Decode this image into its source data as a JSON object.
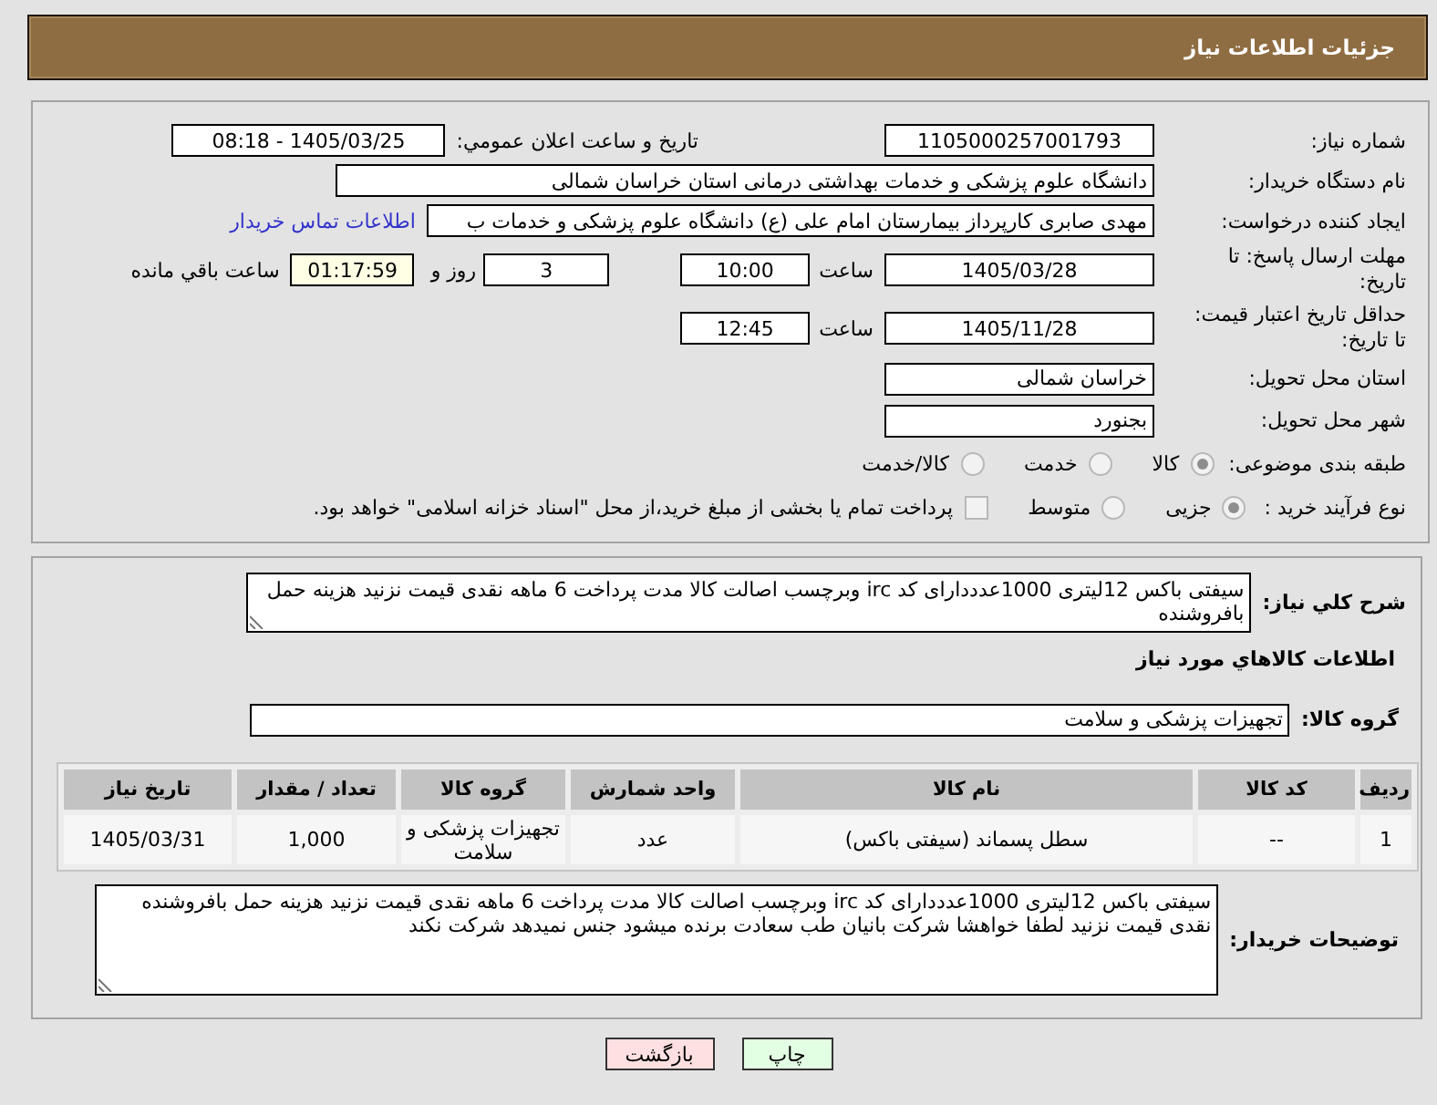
{
  "header": {
    "title": "جزئیات اطلاعات نیاز"
  },
  "details": {
    "need_number": {
      "label": "شماره نیاز:",
      "value": "1105000257001793"
    },
    "announcement": {
      "label": "تاریخ و ساعت اعلان عمومي:",
      "value": "1405/03/25 - 08:18"
    },
    "buyer_org": {
      "label": "نام دستگاه خریدار:",
      "value": "دانشگاه علوم پزشکی و خدمات بهداشتی درمانی استان خراسان شمالی"
    },
    "requester": {
      "label": "ایجاد کننده درخواست:",
      "value": "مهدی صابری کارپرداز بیمارستان امام علی (ع) دانشگاه علوم پزشکی و خدمات ب",
      "contact_link": "اطلاعات تماس خریدار"
    },
    "reply_deadline": {
      "label": "مهلت ارسال پاسخ: تا تاریخ:",
      "date": "1405/03/28",
      "time_label": "ساعت",
      "time": "10:00",
      "days": "3",
      "days_label": "روز و",
      "remaining": "01:17:59",
      "remaining_label": "ساعت باقي مانده"
    },
    "price_validity": {
      "label": "حداقل تاریخ اعتبار قیمت: تا تاریخ:",
      "date": "1405/11/28",
      "time_label": "ساعت",
      "time": "12:45"
    },
    "delivery_province": {
      "label": "استان محل تحویل:",
      "value": "خراسان شمالی"
    },
    "delivery_city": {
      "label": "شهر محل تحویل:",
      "value": "بجنورد"
    },
    "category": {
      "label": "طبقه بندی موضوعی:",
      "options": [
        {
          "label": "کالا",
          "selected": true
        },
        {
          "label": "خدمت",
          "selected": false
        },
        {
          "label": "کالا/خدمت",
          "selected": false
        }
      ]
    },
    "purchase_process": {
      "label": "نوع فرآیند خرید :",
      "options": [
        {
          "label": "جزیی",
          "selected": true
        },
        {
          "label": "متوسط",
          "selected": false
        }
      ],
      "treasury_payment": {
        "label": "پرداخت تمام یا بخشی از مبلغ خرید،از محل \"اسناد خزانه اسلامی\" خواهد بود.",
        "checked": false
      }
    }
  },
  "needs": {
    "summary_label": "شرح کلي نیاز:",
    "summary": "سیفتی باکس 12لیتری 1000عدددارای کد irc وبرچسب اصالت کالا مدت پرداخت 6 ماهه نقدی قیمت نزنید هزینه حمل بافروشنده",
    "goods_title": "اطلاعات کالاهاي مورد نیاز",
    "group_label": "گروه کالا:",
    "group": "تجهیزات پزشکی و سلامت",
    "table": {
      "columns": [
        "ردیف",
        "کد کالا",
        "نام کالا",
        "واحد شمارش",
        "گروه کالا",
        "تعداد / مقدار",
        "تاریخ نیاز"
      ],
      "rows": [
        [
          "1",
          "--",
          "سطل پسماند (سیفتی باکس)",
          "عدد",
          "تجهیزات پزشکی و سلامت",
          "1,000",
          "1405/03/31"
        ]
      ]
    },
    "buyer_notes_label": "توضیحات خریدار:",
    "buyer_notes": "سیفتی باکس 12لیتری 1000عدددارای کد irc وبرچسب اصالت کالا مدت پرداخت 6 ماهه نقدی قیمت نزنید هزینه حمل بافروشنده نقدی قیمت نزنید لطفا خواهشا شرکت بانیان طب سعادت برنده میشود جنس نمیدهد شرکت نکند"
  },
  "buttons": [
    {
      "label": "چاپ",
      "kind": "print"
    },
    {
      "label": "بازگشت",
      "kind": "back"
    }
  ]
}
